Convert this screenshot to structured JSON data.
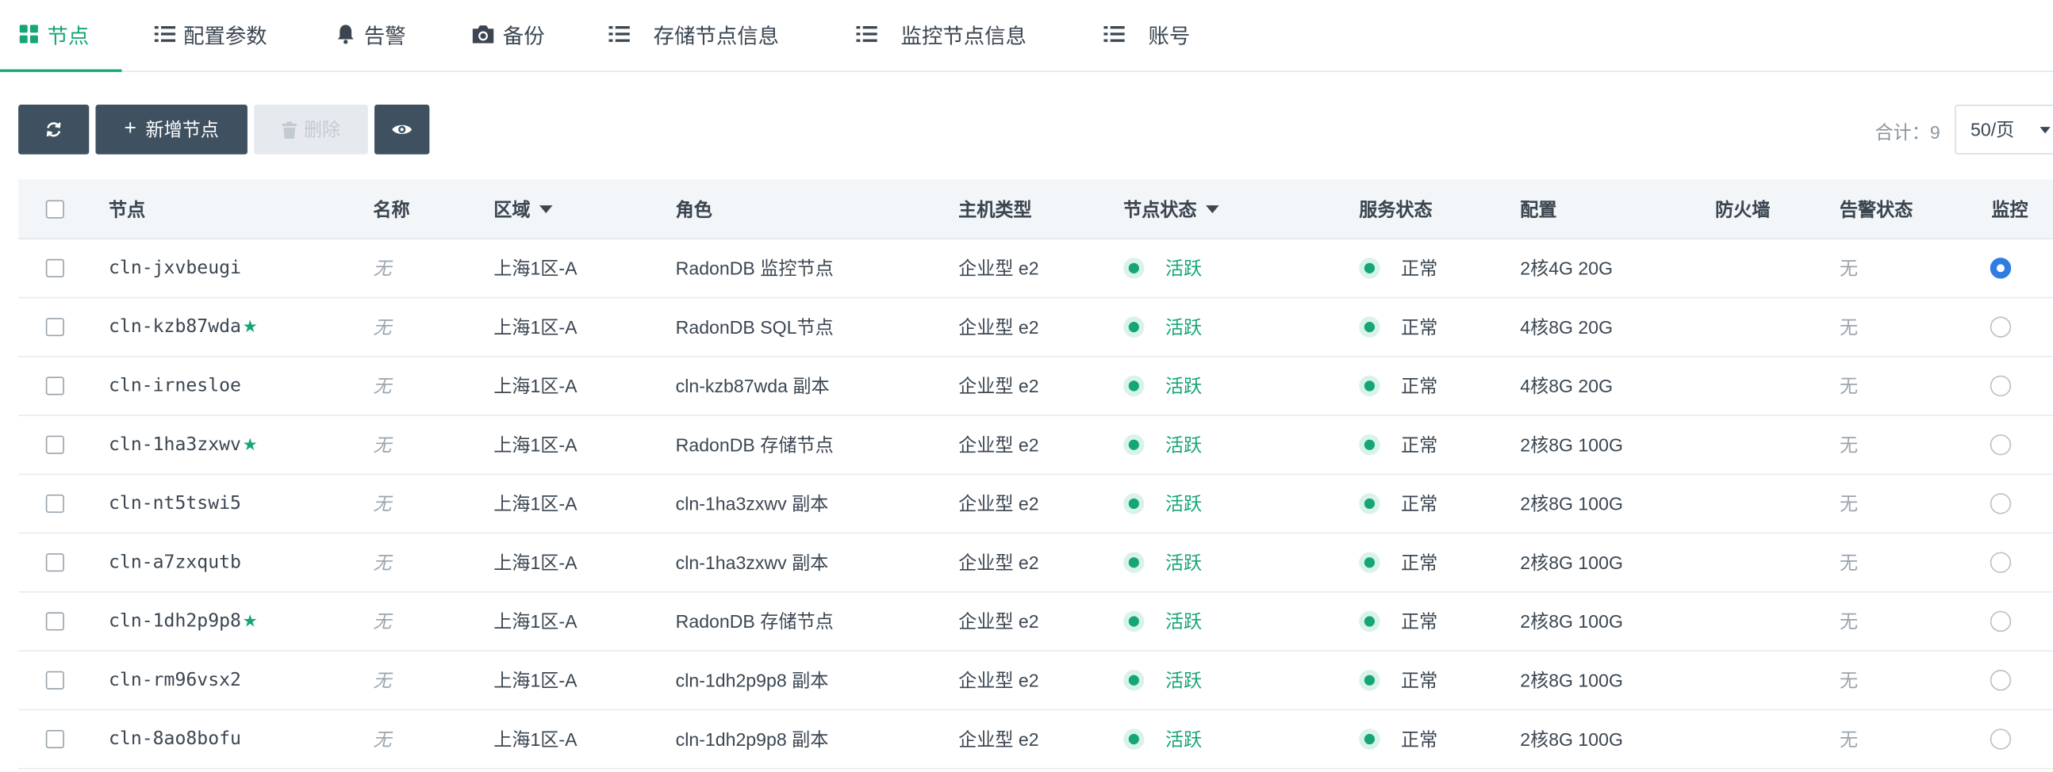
{
  "tabs": [
    {
      "label": "节点",
      "icon": "grid-icon",
      "active": true
    },
    {
      "label": "配置参数",
      "icon": "list-icon"
    },
    {
      "label": "告警",
      "icon": "bell-icon"
    },
    {
      "label": "备份",
      "icon": "camera-icon"
    },
    {
      "label": "存储节点信息",
      "icon": "list-icon"
    },
    {
      "label": "监控节点信息",
      "icon": "list-icon"
    },
    {
      "label": "账号",
      "icon": "list-icon"
    }
  ],
  "toolbar": {
    "refresh_icon": "refresh-icon",
    "add_label": "新增节点",
    "delete_label": "删除",
    "eye_icon": "eye-icon",
    "total_label": "合计：9",
    "page_size": "50/页"
  },
  "table": {
    "headers": [
      "节点",
      "名称",
      "区域",
      "角色",
      "主机类型",
      "节点状态",
      "服务状态",
      "配置",
      "防火墙",
      "告警状态",
      "监控"
    ],
    "rows": [
      {
        "node": "cln-jxvbeugi",
        "star": false,
        "name": "无",
        "zone": "上海1区-A",
        "role": "RadonDB 监控节点",
        "host": "企业型 e2",
        "node_status": "活跃",
        "service_status": "正常",
        "config": "2核4G 20G",
        "firewall": "",
        "alert": "无",
        "monitor": true
      },
      {
        "node": "cln-kzb87wda",
        "star": true,
        "name": "无",
        "zone": "上海1区-A",
        "role": "RadonDB SQL节点",
        "host": "企业型 e2",
        "node_status": "活跃",
        "service_status": "正常",
        "config": "4核8G 20G",
        "firewall": "",
        "alert": "无",
        "monitor": false
      },
      {
        "node": "cln-irnesloe",
        "star": false,
        "name": "无",
        "zone": "上海1区-A",
        "role": "cln-kzb87wda 副本",
        "host": "企业型 e2",
        "node_status": "活跃",
        "service_status": "正常",
        "config": "4核8G 20G",
        "firewall": "",
        "alert": "无",
        "monitor": false
      },
      {
        "node": "cln-1ha3zxwv",
        "star": true,
        "name": "无",
        "zone": "上海1区-A",
        "role": "RadonDB 存储节点",
        "host": "企业型 e2",
        "node_status": "活跃",
        "service_status": "正常",
        "config": "2核8G 100G",
        "firewall": "",
        "alert": "无",
        "monitor": false
      },
      {
        "node": "cln-nt5tswi5",
        "star": false,
        "name": "无",
        "zone": "上海1区-A",
        "role": "cln-1ha3zxwv 副本",
        "host": "企业型 e2",
        "node_status": "活跃",
        "service_status": "正常",
        "config": "2核8G 100G",
        "firewall": "",
        "alert": "无",
        "monitor": false
      },
      {
        "node": "cln-a7zxqutb",
        "star": false,
        "name": "无",
        "zone": "上海1区-A",
        "role": "cln-1ha3zxwv 副本",
        "host": "企业型 e2",
        "node_status": "活跃",
        "service_status": "正常",
        "config": "2核8G 100G",
        "firewall": "",
        "alert": "无",
        "monitor": false
      },
      {
        "node": "cln-1dh2p9p8",
        "star": true,
        "name": "无",
        "zone": "上海1区-A",
        "role": "RadonDB 存储节点",
        "host": "企业型 e2",
        "node_status": "活跃",
        "service_status": "正常",
        "config": "2核8G 100G",
        "firewall": "",
        "alert": "无",
        "monitor": false
      },
      {
        "node": "cln-rm96vsx2",
        "star": false,
        "name": "无",
        "zone": "上海1区-A",
        "role": "cln-1dh2p9p8 副本",
        "host": "企业型 e2",
        "node_status": "活跃",
        "service_status": "正常",
        "config": "2核8G 100G",
        "firewall": "",
        "alert": "无",
        "monitor": false
      },
      {
        "node": "cln-8ao8bofu",
        "star": false,
        "name": "无",
        "zone": "上海1区-A",
        "role": "cln-1dh2p9p8 副本",
        "host": "企业型 e2",
        "node_status": "活跃",
        "service_status": "正常",
        "config": "2核8G 100G",
        "firewall": "",
        "alert": "无",
        "monitor": false
      }
    ]
  },
  "colors": {
    "accent": "#15a675",
    "button_dark": "#3f5160",
    "radio_selected": "#2f7de1"
  }
}
